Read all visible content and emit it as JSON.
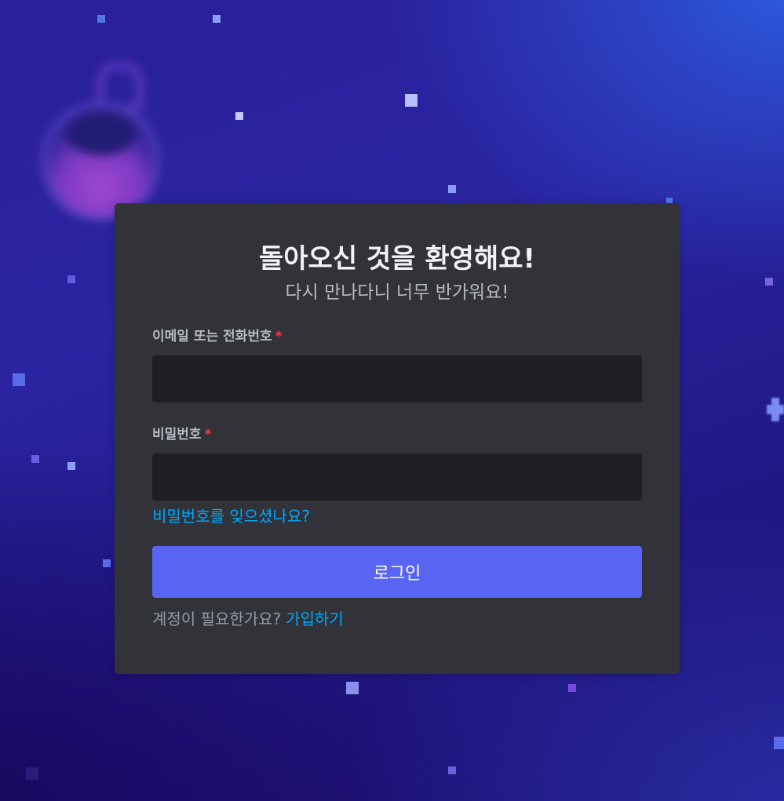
{
  "login": {
    "title": "돌아오신 것을 환영해요!",
    "subtitle": "다시 만나다니 너무 반가워요!",
    "email_label": "이메일 또는 전화번호",
    "password_label": "비밀번호",
    "required_mark": "*",
    "email_value": "",
    "password_value": "",
    "forgot_password": "비밀번호를 잊으셨나요?",
    "login_button": "로그인",
    "need_account": "계정이 필요한가요?",
    "register_link": "가입하기"
  },
  "colors": {
    "card_background": "#313338",
    "input_background": "#1e1f22",
    "primary_button": "#5865f2",
    "link": "#00a8fc",
    "required": "#f23f42"
  },
  "background": {
    "decorations": [
      "flask-illustration",
      "star-particles",
      "sparkle"
    ]
  }
}
